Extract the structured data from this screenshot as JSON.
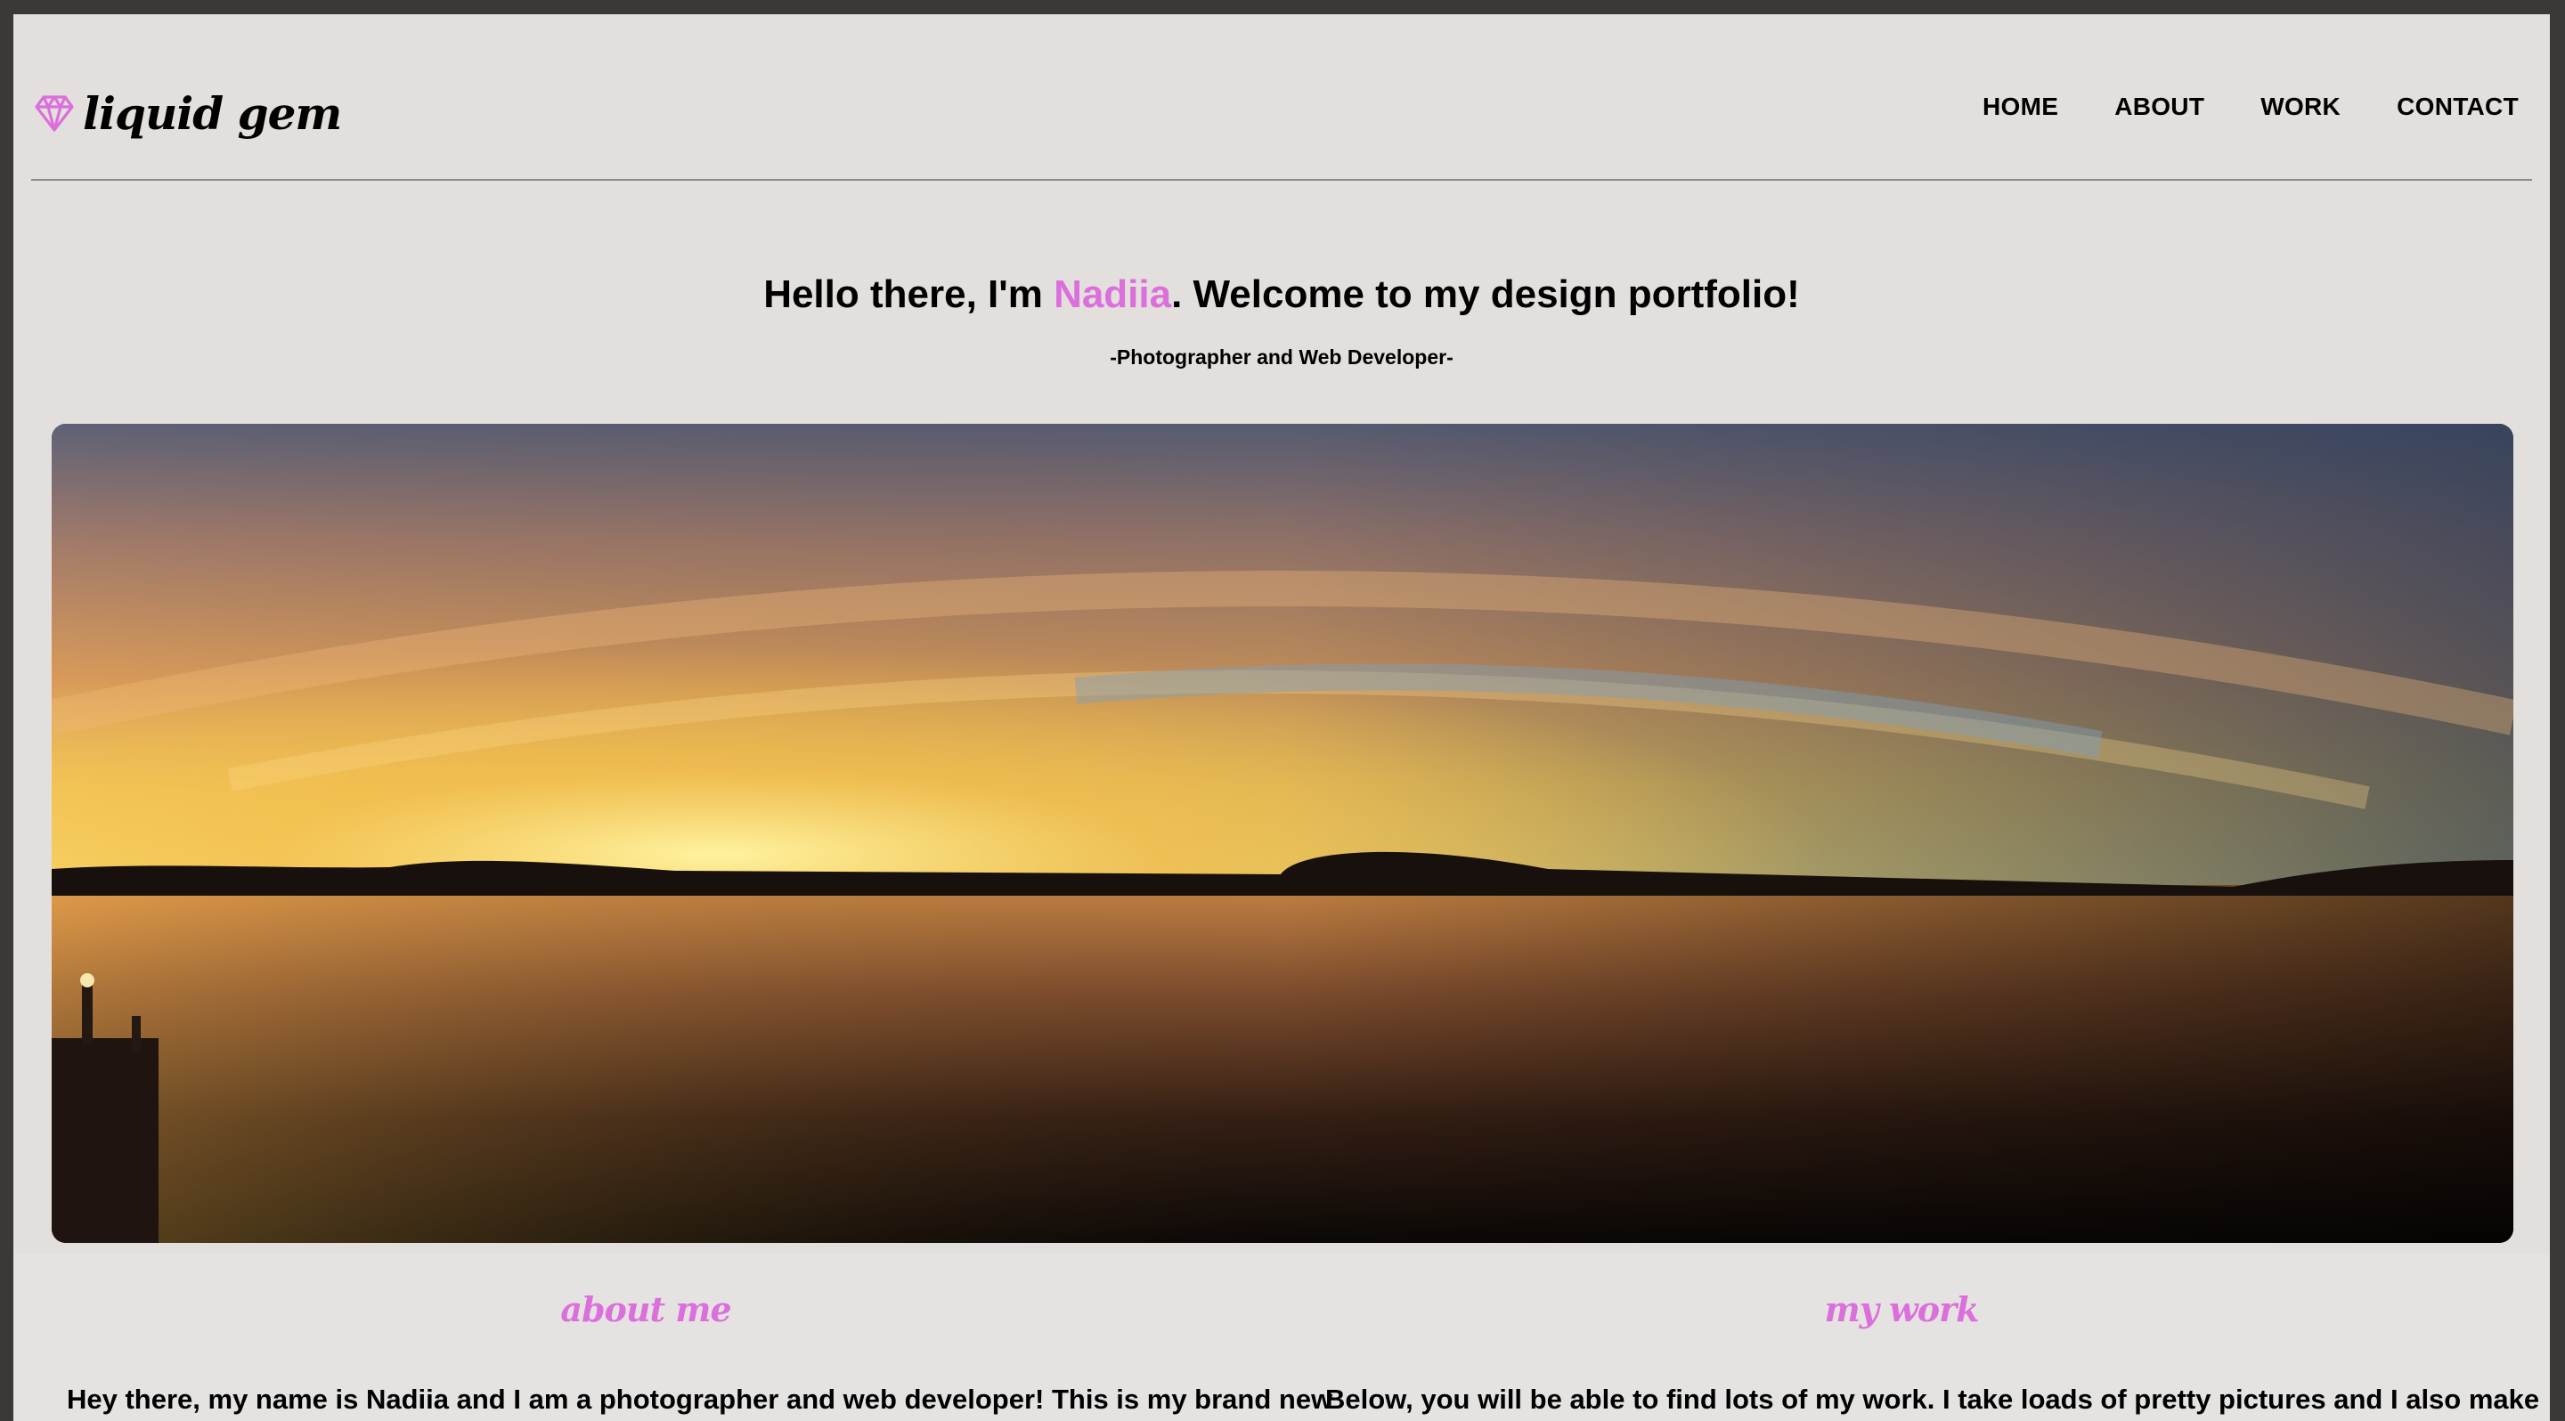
{
  "brand": {
    "name": "liquid gem",
    "icon": "diamond-icon",
    "accent_color": "#db6fdb"
  },
  "nav": {
    "items": [
      "HOME",
      "ABOUT",
      "WORK",
      "CONTACT"
    ]
  },
  "hero": {
    "heading_before": "Hello there, I'm ",
    "heading_name": "Nadiia",
    "heading_after": ". Welcome to my design portfolio!",
    "subheading": "-Photographer and Web Developer-"
  },
  "about": {
    "title": "about me",
    "text": "Hey there, my name is Nadiia and I am a photographer and web developer! This is my brand new"
  },
  "work": {
    "title": "my work",
    "text": "Below, you will be able to find lots of my work. I take loads of pretty pictures and I also make"
  },
  "colors": {
    "background": "#e2dfdd",
    "accent": "#db6fdb",
    "text": "#000000"
  }
}
